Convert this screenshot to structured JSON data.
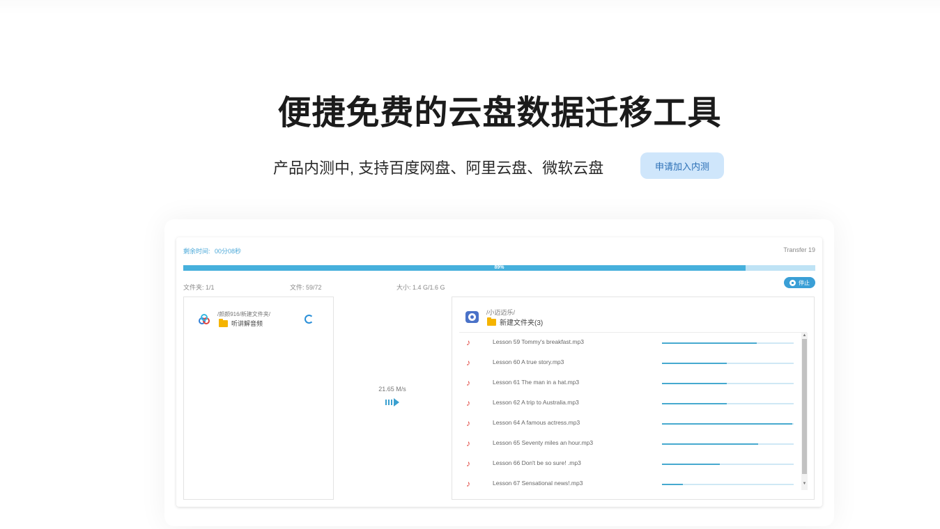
{
  "hero": {
    "title": "便捷免费的云盘数据迁移工具",
    "subtitle": "产品内测中, 支持百度网盘、阿里云盘、微软云盘",
    "join_button": "申请加入内测"
  },
  "transfer": {
    "remaining_label": "剩余时间:",
    "remaining_value": "00分08秒",
    "transfer_id": "Transfer 19",
    "progress_label": "89%",
    "progress_value": 0.89,
    "folders_stat": "文件夹: 1/1",
    "files_stat": "文件: 59/72",
    "size_stat": "大小: 1.4 G/1.6 G",
    "stop_label": "停止",
    "speed": "21.65 M/s"
  },
  "source": {
    "icon": "baidu-cloud-icon",
    "path": "/颜颜916/新建文件夹/",
    "folder": "听讲解音频"
  },
  "destination": {
    "icon": "microsoft-drive-icon",
    "path": "/小迈迈乐/",
    "folder": "新建文件夹(3)"
  },
  "files": [
    {
      "name": "Lesson 59 Tommy's breakfast.mp3",
      "progress": 0.72
    },
    {
      "name": "Lesson 60 A true story.mp3",
      "progress": 0.49
    },
    {
      "name": "Lesson 61 The man in a hat.mp3",
      "progress": 0.49
    },
    {
      "name": "Lesson 62 A trip to Australia.mp3",
      "progress": 0.49
    },
    {
      "name": "Lesson 64 A famous actress.mp3",
      "progress": 0.99
    },
    {
      "name": "Lesson 65 Seventy miles an hour.mp3",
      "progress": 0.73
    },
    {
      "name": "Lesson 66 Don't be so sure! .mp3",
      "progress": 0.44
    },
    {
      "name": "Lesson 67 Sensational news!.mp3",
      "progress": 0.16
    }
  ],
  "colors": {
    "accent": "#46b0dc",
    "button_bg": "#cfe6fb",
    "note_icon": "#e0433c",
    "folder": "#f5b400"
  }
}
